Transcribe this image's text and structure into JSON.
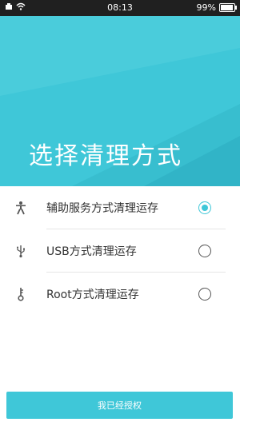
{
  "status_bar": {
    "time": "08:13",
    "battery": "99%"
  },
  "header": {
    "title": "选择清理方式"
  },
  "options": [
    {
      "icon": "accessibility-icon",
      "label": "辅助服务方式清理运存",
      "selected": true
    },
    {
      "icon": "usb-icon",
      "label": "USB方式清理运存",
      "selected": false
    },
    {
      "icon": "key-icon",
      "label": "Root方式清理运存",
      "selected": false
    }
  ],
  "footer": {
    "button_label": "我已经授权"
  },
  "colors": {
    "accent": "#3fc7d8"
  }
}
